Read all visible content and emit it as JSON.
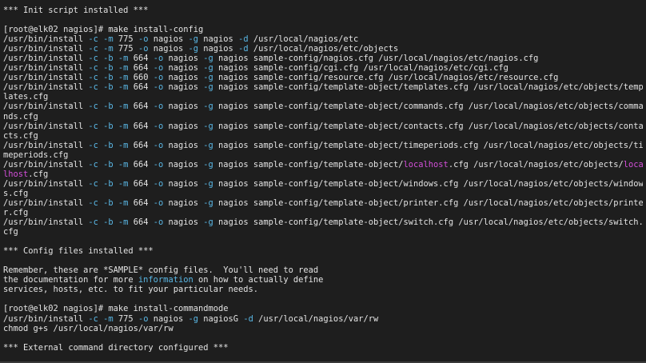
{
  "terminal": {
    "lines": [
      [
        {
          "t": "*** Init script installed ***"
        }
      ],
      [
        {
          "t": ""
        }
      ],
      [
        {
          "t": "[root@elk02 nagios]# make install-config"
        }
      ],
      [
        {
          "t": "/usr/bin/install "
        },
        {
          "t": "-c",
          "c": "flag"
        },
        {
          "t": " "
        },
        {
          "t": "-m",
          "c": "flag"
        },
        {
          "t": " 775 "
        },
        {
          "t": "-o",
          "c": "flag"
        },
        {
          "t": " nagios "
        },
        {
          "t": "-g",
          "c": "flag"
        },
        {
          "t": " nagios "
        },
        {
          "t": "-d",
          "c": "flag"
        },
        {
          "t": " /usr/local/nagios/etc"
        }
      ],
      [
        {
          "t": "/usr/bin/install "
        },
        {
          "t": "-c",
          "c": "flag"
        },
        {
          "t": " "
        },
        {
          "t": "-m",
          "c": "flag"
        },
        {
          "t": " 775 "
        },
        {
          "t": "-o",
          "c": "flag"
        },
        {
          "t": " nagios "
        },
        {
          "t": "-g",
          "c": "flag"
        },
        {
          "t": " nagios "
        },
        {
          "t": "-d",
          "c": "flag"
        },
        {
          "t": " /usr/local/nagios/etc/objects"
        }
      ],
      [
        {
          "t": "/usr/bin/install "
        },
        {
          "t": "-c",
          "c": "flag"
        },
        {
          "t": " "
        },
        {
          "t": "-b",
          "c": "flag"
        },
        {
          "t": " "
        },
        {
          "t": "-m",
          "c": "flag"
        },
        {
          "t": " 664 "
        },
        {
          "t": "-o",
          "c": "flag"
        },
        {
          "t": " nagios "
        },
        {
          "t": "-g",
          "c": "flag"
        },
        {
          "t": " nagios sample-config/nagios.cfg /usr/local/nagios/etc/nagios.cfg"
        }
      ],
      [
        {
          "t": "/usr/bin/install "
        },
        {
          "t": "-c",
          "c": "flag"
        },
        {
          "t": " "
        },
        {
          "t": "-b",
          "c": "flag"
        },
        {
          "t": " "
        },
        {
          "t": "-m",
          "c": "flag"
        },
        {
          "t": " 664 "
        },
        {
          "t": "-o",
          "c": "flag"
        },
        {
          "t": " nagios "
        },
        {
          "t": "-g",
          "c": "flag"
        },
        {
          "t": " nagios sample-config/cgi.cfg /usr/local/nagios/etc/cgi.cfg"
        }
      ],
      [
        {
          "t": "/usr/bin/install "
        },
        {
          "t": "-c",
          "c": "flag"
        },
        {
          "t": " "
        },
        {
          "t": "-b",
          "c": "flag"
        },
        {
          "t": " "
        },
        {
          "t": "-m",
          "c": "flag"
        },
        {
          "t": " 660 "
        },
        {
          "t": "-o",
          "c": "flag"
        },
        {
          "t": " nagios "
        },
        {
          "t": "-g",
          "c": "flag"
        },
        {
          "t": " nagios sample-config/resource.cfg /usr/local/nagios/etc/resource.cfg"
        }
      ],
      [
        {
          "t": "/usr/bin/install "
        },
        {
          "t": "-c",
          "c": "flag"
        },
        {
          "t": " "
        },
        {
          "t": "-b",
          "c": "flag"
        },
        {
          "t": " "
        },
        {
          "t": "-m",
          "c": "flag"
        },
        {
          "t": " 664 "
        },
        {
          "t": "-o",
          "c": "flag"
        },
        {
          "t": " nagios "
        },
        {
          "t": "-g",
          "c": "flag"
        },
        {
          "t": " nagios sample-config/template-object/templates.cfg /usr/local/nagios/etc/objects/temp"
        }
      ],
      [
        {
          "t": "lates.cfg"
        }
      ],
      [
        {
          "t": "/usr/bin/install "
        },
        {
          "t": "-c",
          "c": "flag"
        },
        {
          "t": " "
        },
        {
          "t": "-b",
          "c": "flag"
        },
        {
          "t": " "
        },
        {
          "t": "-m",
          "c": "flag"
        },
        {
          "t": " 664 "
        },
        {
          "t": "-o",
          "c": "flag"
        },
        {
          "t": " nagios "
        },
        {
          "t": "-g",
          "c": "flag"
        },
        {
          "t": " nagios sample-config/template-object/commands.cfg /usr/local/nagios/etc/objects/comma"
        }
      ],
      [
        {
          "t": "nds.cfg"
        }
      ],
      [
        {
          "t": "/usr/bin/install "
        },
        {
          "t": "-c",
          "c": "flag"
        },
        {
          "t": " "
        },
        {
          "t": "-b",
          "c": "flag"
        },
        {
          "t": " "
        },
        {
          "t": "-m",
          "c": "flag"
        },
        {
          "t": " 664 "
        },
        {
          "t": "-o",
          "c": "flag"
        },
        {
          "t": " nagios "
        },
        {
          "t": "-g",
          "c": "flag"
        },
        {
          "t": " nagios sample-config/template-object/contacts.cfg /usr/local/nagios/etc/objects/conta"
        }
      ],
      [
        {
          "t": "cts.cfg"
        }
      ],
      [
        {
          "t": "/usr/bin/install "
        },
        {
          "t": "-c",
          "c": "flag"
        },
        {
          "t": " "
        },
        {
          "t": "-b",
          "c": "flag"
        },
        {
          "t": " "
        },
        {
          "t": "-m",
          "c": "flag"
        },
        {
          "t": " 664 "
        },
        {
          "t": "-o",
          "c": "flag"
        },
        {
          "t": " nagios "
        },
        {
          "t": "-g",
          "c": "flag"
        },
        {
          "t": " nagios sample-config/template-object/timeperiods.cfg /usr/local/nagios/etc/objects/ti"
        }
      ],
      [
        {
          "t": "meperiods.cfg"
        }
      ],
      [
        {
          "t": "/usr/bin/install "
        },
        {
          "t": "-c",
          "c": "flag"
        },
        {
          "t": " "
        },
        {
          "t": "-b",
          "c": "flag"
        },
        {
          "t": " "
        },
        {
          "t": "-m",
          "c": "flag"
        },
        {
          "t": " 664 "
        },
        {
          "t": "-o",
          "c": "flag"
        },
        {
          "t": " nagios "
        },
        {
          "t": "-g",
          "c": "flag"
        },
        {
          "t": " nagios sample-config/template-object/"
        },
        {
          "t": "localhost",
          "c": "hl"
        },
        {
          "t": ".cfg /usr/local/nagios/etc/objects/"
        },
        {
          "t": "loca",
          "c": "hl"
        }
      ],
      [
        {
          "t": "lhost",
          "c": "hl"
        },
        {
          "t": ".cfg"
        }
      ],
      [
        {
          "t": "/usr/bin/install "
        },
        {
          "t": "-c",
          "c": "flag"
        },
        {
          "t": " "
        },
        {
          "t": "-b",
          "c": "flag"
        },
        {
          "t": " "
        },
        {
          "t": "-m",
          "c": "flag"
        },
        {
          "t": " 664 "
        },
        {
          "t": "-o",
          "c": "flag"
        },
        {
          "t": " nagios "
        },
        {
          "t": "-g",
          "c": "flag"
        },
        {
          "t": " nagios sample-config/template-object/windows.cfg /usr/local/nagios/etc/objects/window"
        }
      ],
      [
        {
          "t": "s.cfg"
        }
      ],
      [
        {
          "t": "/usr/bin/install "
        },
        {
          "t": "-c",
          "c": "flag"
        },
        {
          "t": " "
        },
        {
          "t": "-b",
          "c": "flag"
        },
        {
          "t": " "
        },
        {
          "t": "-m",
          "c": "flag"
        },
        {
          "t": " 664 "
        },
        {
          "t": "-o",
          "c": "flag"
        },
        {
          "t": " nagios "
        },
        {
          "t": "-g",
          "c": "flag"
        },
        {
          "t": " nagios sample-config/template-object/printer.cfg /usr/local/nagios/etc/objects/printe"
        }
      ],
      [
        {
          "t": "r.cfg"
        }
      ],
      [
        {
          "t": "/usr/bin/install "
        },
        {
          "t": "-c",
          "c": "flag"
        },
        {
          "t": " "
        },
        {
          "t": "-b",
          "c": "flag"
        },
        {
          "t": " "
        },
        {
          "t": "-m",
          "c": "flag"
        },
        {
          "t": " 664 "
        },
        {
          "t": "-o",
          "c": "flag"
        },
        {
          "t": " nagios "
        },
        {
          "t": "-g",
          "c": "flag"
        },
        {
          "t": " nagios sample-config/template-object/switch.cfg /usr/local/nagios/etc/objects/switch."
        }
      ],
      [
        {
          "t": "cfg"
        }
      ],
      [
        {
          "t": ""
        }
      ],
      [
        {
          "t": "*** Config files installed ***"
        }
      ],
      [
        {
          "t": ""
        }
      ],
      [
        {
          "t": "Remember, these are *SAMPLE* config files.  You'll need to read"
        }
      ],
      [
        {
          "t": "the documentation for more "
        },
        {
          "t": "information",
          "c": "kw"
        },
        {
          "t": " on how to actually define"
        }
      ],
      [
        {
          "t": "services, hosts, etc. to fit your particular needs."
        }
      ],
      [
        {
          "t": ""
        }
      ],
      [
        {
          "t": "[root@elk02 nagios]# make install-commandmode"
        }
      ],
      [
        {
          "t": "/usr/bin/install "
        },
        {
          "t": "-c",
          "c": "flag"
        },
        {
          "t": " "
        },
        {
          "t": "-m",
          "c": "flag"
        },
        {
          "t": " 775 "
        },
        {
          "t": "-o",
          "c": "flag"
        },
        {
          "t": " nagios "
        },
        {
          "t": "-g",
          "c": "flag"
        },
        {
          "t": " nagiosG "
        },
        {
          "t": "-d",
          "c": "flag"
        },
        {
          "t": " /usr/local/nagios/var/rw"
        }
      ],
      [
        {
          "t": "chmod g+s /usr/local/nagios/var/rw"
        }
      ],
      [
        {
          "t": ""
        }
      ],
      [
        {
          "t": "*** External command directory configured ***"
        }
      ]
    ]
  }
}
